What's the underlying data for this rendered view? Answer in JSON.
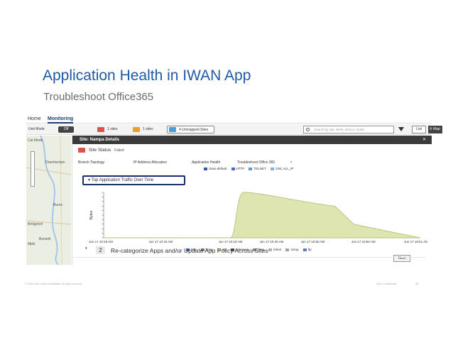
{
  "slide": {
    "title": "Application Health in IWAN App",
    "subtitle": "Troubleshoot Office365",
    "footer_left": "© 2015 Cisco and/or its affiliates. All rights reserved.",
    "footer_right": "Cisco Confidential",
    "page_number": "36"
  },
  "app": {
    "nav": {
      "home": "Home",
      "monitoring": "Monitoring"
    },
    "toolbar": {
      "view_label": "Unit Mode",
      "toggle_value": "Off",
      "site_a_count": "1 sites",
      "site_b_count": "1 sites",
      "unmapped_label": "4 Unmapped Sites",
      "search_placeholder": "Search by site, WAN, device, router",
      "list_button": "List",
      "map_button": "Map"
    },
    "map": {
      "places": [
        "Cal Mode",
        "Chamberlain",
        "Burns",
        "Bridgeton",
        "Burwell",
        "Mpls"
      ]
    },
    "panel": {
      "header": "Site: Nampa Details",
      "close_label": "✕",
      "site_status_label": "Site Status",
      "site_status_value": "Failed",
      "tabs": [
        "Branch Topology",
        "IP Address Allocation",
        "Application Health",
        "Troubleshoot Office 365"
      ],
      "tab_close": "✕",
      "top_legend": [
        {
          "label": "class-default",
          "color": "#2f5aa8"
        },
        {
          "label": "HTTP",
          "color": "#3f6fc8"
        },
        {
          "label": "TELNET",
          "color": "#5a9ad6"
        },
        {
          "label": "CIM_ALL_IP",
          "color": "#7fb0e0"
        }
      ],
      "section_label": "Top Application Traffic Over Time",
      "next_button": "Next",
      "bottom_legend": [
        {
          "label": "http",
          "color": "#3a64b0"
        },
        {
          "label": "icmp",
          "color": "#7a7a7a"
        },
        {
          "label": "ntp",
          "color": "#c9d07e"
        },
        {
          "label": "unknown",
          "color": "#4a4a4a"
        },
        {
          "label": "ping",
          "color": "#8a8a8a"
        },
        {
          "label": "telnet",
          "color": "#b0b0b0"
        },
        {
          "label": "snmp",
          "color": "#9aa3b0"
        },
        {
          "label": "ftp",
          "color": "#5b7fb5"
        }
      ]
    },
    "step2": {
      "number": "2",
      "text": "Re-categorize Apps and/or Update App Policy Across Sites"
    }
  },
  "chart_data": {
    "type": "area",
    "ylabel": "Bytes",
    "x": [
      "Jun 17 10:18 AM",
      "Jun 17 10:18 AM",
      "Jun 17 10:18 AM",
      "Jun 17 10:30 AM",
      "Jun 17 10:50 AM",
      "Jun 17 10:50 AM",
      "Jun 17 10:51 AM"
    ],
    "series": [
      {
        "name": "ntp",
        "values": [
          0,
          0,
          0,
          10,
          7,
          3,
          0
        ]
      }
    ],
    "fill_color": "#dfe5b0",
    "stroke_color": "#b5bb6e"
  }
}
